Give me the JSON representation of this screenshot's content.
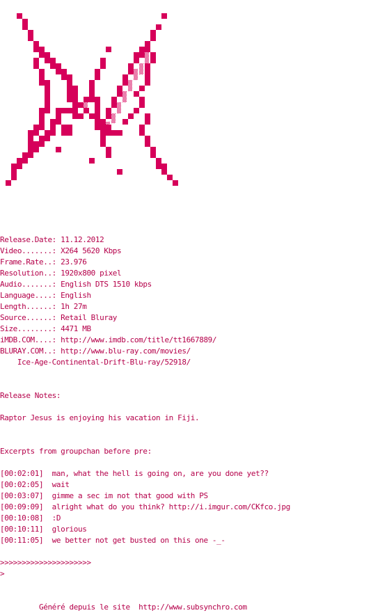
{
  "colors": {
    "ink": "#b5004a",
    "logo": "#d6005a",
    "background": "#ffffff"
  },
  "logo_icon": "pixel-art-butterfly-icon",
  "lines": [
    "Release.Date: 11.12.2012",
    "Video.......: X264 5620 Kbps",
    "Frame.Rate..: 23.976",
    "Resolution..: 1920x800 pixel",
    "Audio.......: English DTS 1510 kbps",
    "Language....: English",
    "Length......: 1h 27m",
    "Source......: Retail Bluray",
    "Size........: 4471 MB",
    "iMDB.COM....: http://www.imdb.com/title/tt1667889/",
    "BLURAY.COM..: http://www.blu-ray.com/movies/",
    "    Ice-Age-Continental-Drift-Blu-ray/52918/",
    "",
    "",
    "Release Notes:",
    "",
    "Raptor Jesus is enjoying his vacation in Fiji.",
    "",
    "",
    "Excerpts from groupchan before pre:",
    "",
    "[00:02:01]  man, what the hell is going on, are you done yet??",
    "[00:02:05]  wait",
    "[00:03:07]  gimme a sec im not that good with PS",
    "[00:09:09]  alright what do you think? http://i.imgur.com/CKfco.jpg",
    "[00:10:08]  :D",
    "[00:10:11]  glorious",
    "[00:11:05]  we better not get busted on this one -_-",
    "",
    ">>>>>>>>>>>>>>>>>>>>>",
    ">",
    "",
    "",
    "         Généré depuis le site  http://www.subsynchro.com"
  ]
}
